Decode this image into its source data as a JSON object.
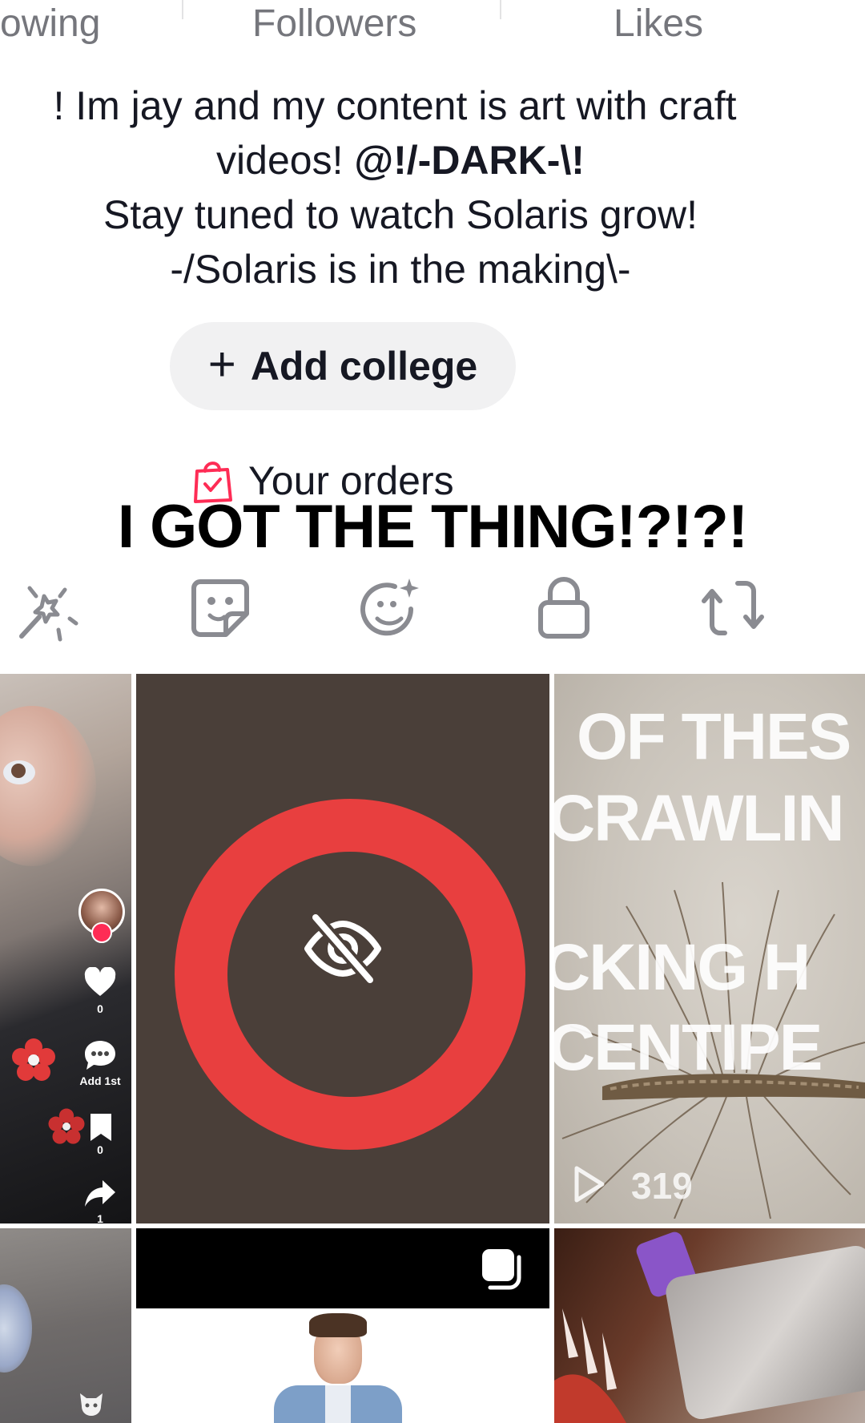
{
  "stats": {
    "following_label": "owing",
    "followers_label": "Followers",
    "likes_label": "Likes"
  },
  "bio": {
    "line1": "! Im jay and my content is art with craft",
    "line2_prefix": "videos! ",
    "mention": "@!/-DARK-\\!",
    "line3": "Stay tuned to watch Solaris grow!",
    "line4": "-/Solaris is in the making\\-"
  },
  "college": {
    "plus": "+",
    "label": "Add college"
  },
  "orders": {
    "label": "Your orders"
  },
  "headline": "I GOT THE THING!?!?!",
  "tabs": [
    {
      "icon": "magic-wand-icon"
    },
    {
      "icon": "sticker-icon"
    },
    {
      "icon": "face-sparkle-icon"
    },
    {
      "icon": "lock-icon"
    },
    {
      "icon": "repost-icon"
    }
  ],
  "grid": {
    "tile1": {
      "like_count": "0",
      "comment_label": "Add 1st",
      "save_count": "0",
      "share_count": "1"
    },
    "tile3": {
      "overlay_lines": [
        "OF THES",
        "CRAWLIN",
        "CKING H",
        "CENTIPE"
      ],
      "play_count": "319"
    }
  },
  "colors": {
    "accent_red": "#fe2c55",
    "hidden_ring": "#e83f3f",
    "muted_text": "#75767c",
    "chip_bg": "#f1f1f2"
  }
}
